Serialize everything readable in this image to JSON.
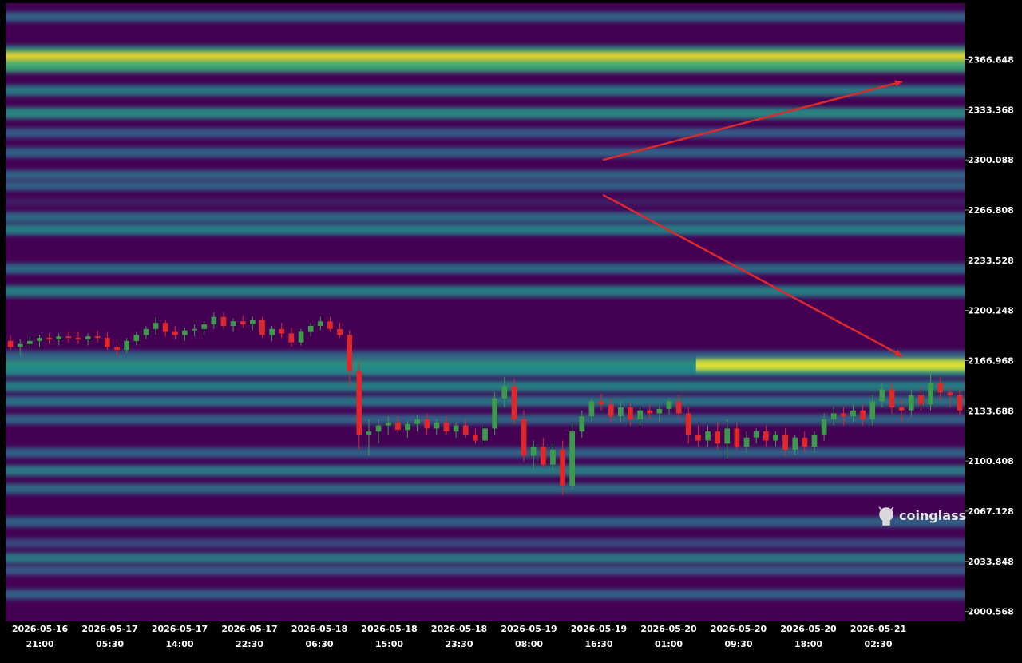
{
  "chart_data": {
    "type": "heatmap",
    "subtype": "liquidation-heatmap-with-candlesticks",
    "title": "",
    "xlabel": "",
    "ylabel": "",
    "y_ticks": [
      2366.648,
      2333.368,
      2300.088,
      2266.808,
      2233.528,
      2200.248,
      2166.968,
      2133.688,
      2100.408,
      2067.128,
      2033.848,
      2000.568
    ],
    "y_tick_labels": [
      "2366.648",
      "2333.368",
      "2300.088",
      "2266.808",
      "2233.528",
      "2200.248",
      "2166.968",
      "2133.688",
      "2100.408",
      "2067.128",
      "2033.848",
      "2000.568"
    ],
    "ylim": [
      1994,
      2404
    ],
    "x_ticks": [
      {
        "date": "2026-05-16",
        "time": "21:00"
      },
      {
        "date": "2026-05-17",
        "time": "05:30"
      },
      {
        "date": "2026-05-17",
        "time": "14:00"
      },
      {
        "date": "2026-05-17",
        "time": "22:30"
      },
      {
        "date": "2026-05-18",
        "time": "06:30"
      },
      {
        "date": "2026-05-18",
        "time": "15:00"
      },
      {
        "date": "2026-05-18",
        "time": "23:30"
      },
      {
        "date": "2026-05-19",
        "time": "08:00"
      },
      {
        "date": "2026-05-19",
        "time": "16:30"
      },
      {
        "date": "2026-05-20",
        "time": "01:00"
      },
      {
        "date": "2026-05-20",
        "time": "09:30"
      },
      {
        "date": "2026-05-20",
        "time": "18:00"
      },
      {
        "date": "2026-05-21",
        "time": "02:30"
      }
    ],
    "colorscale": [
      "#440154",
      "#31688e",
      "#21918c",
      "#35b779",
      "#fde725"
    ],
    "heat_bands": [
      {
        "price": 2395,
        "intensity": 0.3
      },
      {
        "price": 2372,
        "intensity": 0.55
      },
      {
        "price": 2367,
        "intensity": 1.0
      },
      {
        "price": 2362,
        "intensity": 0.7
      },
      {
        "price": 2346,
        "intensity": 0.45
      },
      {
        "price": 2331,
        "intensity": 0.55
      },
      {
        "price": 2318,
        "intensity": 0.25
      },
      {
        "price": 2305,
        "intensity": 0.3
      },
      {
        "price": 2290,
        "intensity": 0.32
      },
      {
        "price": 2283,
        "intensity": 0.3
      },
      {
        "price": 2272,
        "intensity": 0.08
      },
      {
        "price": 2262,
        "intensity": 0.35
      },
      {
        "price": 2254,
        "intensity": 0.5
      },
      {
        "price": 2228,
        "intensity": 0.35
      },
      {
        "price": 2213,
        "intensity": 0.5
      },
      {
        "price": 2170,
        "intensity": 0.3
      },
      {
        "price": 2164,
        "intensity": 0.6
      },
      {
        "price": 2160,
        "intensity": 0.5
      },
      {
        "price": 2150,
        "intensity": 0.5
      },
      {
        "price": 2140,
        "intensity": 0.4
      },
      {
        "price": 2128,
        "intensity": 0.3
      },
      {
        "price": 2106,
        "intensity": 0.3
      },
      {
        "price": 2094,
        "intensity": 0.45
      },
      {
        "price": 2082,
        "intensity": 0.35
      },
      {
        "price": 2060,
        "intensity": 0.3
      },
      {
        "price": 2046,
        "intensity": 0.2
      },
      {
        "price": 2036,
        "intensity": 0.45
      },
      {
        "price": 2028,
        "intensity": 0.25
      },
      {
        "price": 2012,
        "intensity": 0.3
      }
    ],
    "highlight_band": {
      "price": 2164,
      "from_index": 0.72,
      "intensity": 0.95
    },
    "candles": [
      [
        2180,
        2184,
        2174,
        2176
      ],
      [
        2176,
        2181,
        2170,
        2178
      ],
      [
        2178,
        2183,
        2175,
        2180
      ],
      [
        2180,
        2184,
        2176,
        2182
      ],
      [
        2182,
        2185,
        2178,
        2181
      ],
      [
        2181,
        2185,
        2177,
        2183
      ],
      [
        2183,
        2186,
        2179,
        2182
      ],
      [
        2182,
        2186,
        2178,
        2181
      ],
      [
        2181,
        2185,
        2177,
        2183
      ],
      [
        2183,
        2187,
        2179,
        2182
      ],
      [
        2182,
        2186,
        2174,
        2176
      ],
      [
        2176,
        2180,
        2170,
        2174
      ],
      [
        2174,
        2182,
        2172,
        2180
      ],
      [
        2180,
        2186,
        2177,
        2184
      ],
      [
        2184,
        2190,
        2181,
        2188
      ],
      [
        2188,
        2196,
        2184,
        2192
      ],
      [
        2192,
        2194,
        2183,
        2186
      ],
      [
        2186,
        2190,
        2181,
        2184
      ],
      [
        2184,
        2189,
        2180,
        2187
      ],
      [
        2187,
        2191,
        2183,
        2188
      ],
      [
        2188,
        2193,
        2184,
        2191
      ],
      [
        2191,
        2199,
        2188,
        2196
      ],
      [
        2196,
        2199,
        2188,
        2190
      ],
      [
        2190,
        2195,
        2186,
        2193
      ],
      [
        2193,
        2197,
        2189,
        2191
      ],
      [
        2191,
        2196,
        2187,
        2194
      ],
      [
        2194,
        2196,
        2182,
        2184
      ],
      [
        2184,
        2190,
        2180,
        2188
      ],
      [
        2188,
        2192,
        2182,
        2185
      ],
      [
        2185,
        2189,
        2176,
        2179
      ],
      [
        2179,
        2188,
        2177,
        2186
      ],
      [
        2186,
        2192,
        2183,
        2190
      ],
      [
        2190,
        2196,
        2187,
        2193
      ],
      [
        2193,
        2196,
        2186,
        2188
      ],
      [
        2188,
        2192,
        2182,
        2184
      ],
      [
        2184,
        2187,
        2150,
        2160
      ],
      [
        2160,
        2166,
        2108,
        2118
      ],
      [
        2118,
        2128,
        2104,
        2120
      ],
      [
        2120,
        2128,
        2112,
        2124
      ],
      [
        2124,
        2130,
        2118,
        2126
      ],
      [
        2126,
        2130,
        2119,
        2121
      ],
      [
        2121,
        2127,
        2116,
        2125
      ],
      [
        2125,
        2131,
        2120,
        2128
      ],
      [
        2128,
        2132,
        2118,
        2122
      ],
      [
        2122,
        2128,
        2118,
        2126
      ],
      [
        2126,
        2130,
        2118,
        2120
      ],
      [
        2120,
        2126,
        2116,
        2124
      ],
      [
        2124,
        2128,
        2116,
        2118
      ],
      [
        2118,
        2122,
        2112,
        2114
      ],
      [
        2114,
        2124,
        2112,
        2122
      ],
      [
        2122,
        2146,
        2118,
        2142
      ],
      [
        2142,
        2156,
        2136,
        2150
      ],
      [
        2150,
        2155,
        2125,
        2128
      ],
      [
        2128,
        2134,
        2100,
        2104
      ],
      [
        2104,
        2114,
        2094,
        2110
      ],
      [
        2110,
        2116,
        2096,
        2098
      ],
      [
        2098,
        2112,
        2094,
        2108
      ],
      [
        2108,
        2114,
        2078,
        2084
      ],
      [
        2084,
        2126,
        2082,
        2120
      ],
      [
        2120,
        2134,
        2116,
        2130
      ],
      [
        2130,
        2142,
        2126,
        2140
      ],
      [
        2140,
        2145,
        2134,
        2138
      ],
      [
        2138,
        2142,
        2126,
        2130
      ],
      [
        2130,
        2140,
        2126,
        2136
      ],
      [
        2136,
        2139,
        2124,
        2128
      ],
      [
        2128,
        2136,
        2124,
        2134
      ],
      [
        2134,
        2138,
        2128,
        2132
      ],
      [
        2132,
        2137,
        2126,
        2135
      ],
      [
        2135,
        2142,
        2131,
        2140
      ],
      [
        2140,
        2144,
        2129,
        2132
      ],
      [
        2132,
        2136,
        2112,
        2118
      ],
      [
        2118,
        2124,
        2110,
        2114
      ],
      [
        2114,
        2124,
        2110,
        2120
      ],
      [
        2120,
        2126,
        2108,
        2112
      ],
      [
        2112,
        2128,
        2102,
        2122
      ],
      [
        2122,
        2126,
        2108,
        2110
      ],
      [
        2110,
        2120,
        2106,
        2116
      ],
      [
        2116,
        2122,
        2112,
        2120
      ],
      [
        2120,
        2124,
        2110,
        2114
      ],
      [
        2114,
        2120,
        2110,
        2118
      ],
      [
        2118,
        2122,
        2104,
        2108
      ],
      [
        2108,
        2118,
        2104,
        2116
      ],
      [
        2116,
        2120,
        2106,
        2110
      ],
      [
        2110,
        2120,
        2106,
        2118
      ],
      [
        2118,
        2132,
        2114,
        2128
      ],
      [
        2128,
        2136,
        2124,
        2132
      ],
      [
        2132,
        2136,
        2124,
        2130
      ],
      [
        2130,
        2138,
        2126,
        2134
      ],
      [
        2134,
        2138,
        2124,
        2128
      ],
      [
        2128,
        2144,
        2124,
        2140
      ],
      [
        2140,
        2152,
        2136,
        2148
      ],
      [
        2148,
        2152,
        2132,
        2136
      ],
      [
        2136,
        2142,
        2126,
        2134
      ],
      [
        2134,
        2148,
        2130,
        2144
      ],
      [
        2144,
        2150,
        2134,
        2138
      ],
      [
        2138,
        2160,
        2134,
        2152
      ],
      [
        2152,
        2156,
        2140,
        2146
      ],
      [
        2146,
        2150,
        2136,
        2144
      ],
      [
        2144,
        2148,
        2130,
        2134
      ]
    ],
    "annotations": [
      {
        "type": "arrow",
        "from": [
          "2026-05-19 16:30",
          2300
        ],
        "to": [
          "2026-05-21 02:30",
          2352
        ],
        "color": "#e0282a"
      },
      {
        "type": "arrow",
        "from": [
          "2026-05-19 16:30",
          2277
        ],
        "to": [
          "2026-05-21 02:30",
          2170
        ],
        "color": "#e0282a"
      }
    ],
    "colors": {
      "up": "#3c9a4a",
      "down": "#e0282a",
      "background": "#000000",
      "axis_text": "#ffffff"
    }
  },
  "watermark": {
    "text": "coinglass",
    "icon": "coinglass-logo-icon"
  }
}
